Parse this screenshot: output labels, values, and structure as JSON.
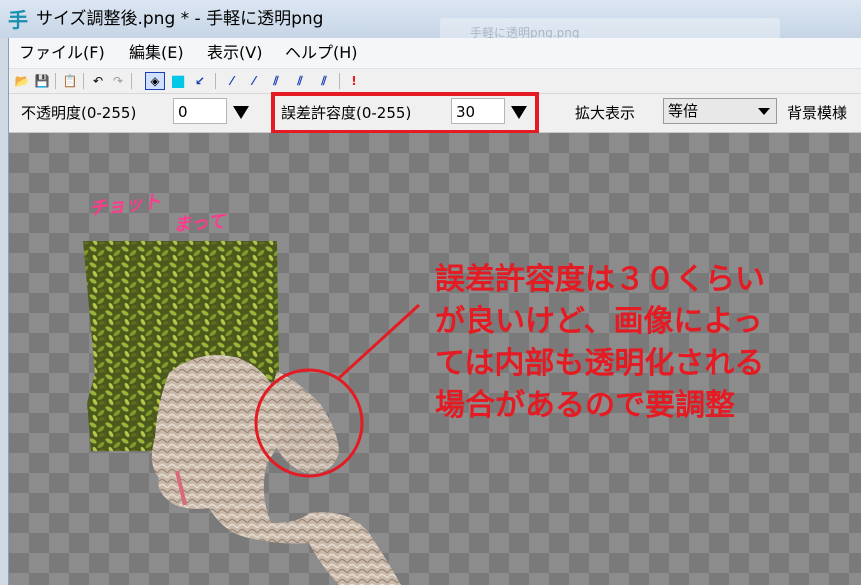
{
  "window": {
    "title": "サイズ調整後.png * - 手軽に透明png",
    "app_icon_glyph": "手",
    "background_window_title": "手軽に透明png.png"
  },
  "menu": [
    {
      "label": "ファイル(F)"
    },
    {
      "label": "編集(E)"
    },
    {
      "label": "表示(V)"
    },
    {
      "label": "ヘルプ(H)"
    }
  ],
  "toolbar": [
    {
      "name": "open-folder-icon",
      "glyph": "📂"
    },
    {
      "name": "save-icon",
      "glyph": "💾"
    },
    {
      "name": "paste-icon",
      "glyph": "📋"
    },
    {
      "name": "undo-icon",
      "glyph": "↶"
    },
    {
      "name": "redo-icon",
      "glyph": "↷"
    },
    {
      "name": "paint-bucket-icon",
      "glyph": "◈"
    },
    {
      "name": "color-swatch-icon",
      "glyph": "■"
    },
    {
      "name": "dropper-icon",
      "glyph": "↙"
    },
    {
      "name": "thin-line-icon",
      "glyph": "⁄"
    },
    {
      "name": "thin-line-2-icon",
      "glyph": "⁄"
    },
    {
      "name": "thick-line-icon",
      "glyph": "⫽"
    },
    {
      "name": "thick-line-2-icon",
      "glyph": "⫽"
    },
    {
      "name": "thickest-line-icon",
      "glyph": "⫽"
    },
    {
      "name": "alert-icon",
      "glyph": "!"
    }
  ],
  "options": {
    "opacity_label": "不透明度(0-255)",
    "opacity_value": "0",
    "tolerance_label": "誤差許容度(0-255)",
    "tolerance_value": "30",
    "zoom_label": "拡大表示",
    "zoom_value": "等倍",
    "background_label": "背景模様"
  },
  "annotations": {
    "handwritten_line1": "チョット",
    "handwritten_line2": "まって",
    "callout_lines": [
      "誤差許容度は３０くらい",
      "が良いけど、画像によっ",
      "ては内部も透明化される",
      "場合があるので要調整"
    ]
  },
  "colors": {
    "highlight_red": "#e51b23",
    "handwriting_pink": "#ff3c8c",
    "toolbar_cyan": "#00c8e6",
    "toolbar_blue": "#1a3fb0"
  }
}
